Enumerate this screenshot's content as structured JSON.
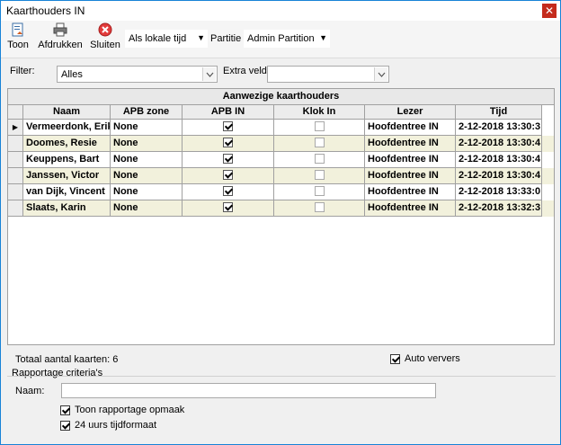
{
  "window": {
    "title": "Kaarthouders IN",
    "close_glyph": "✕"
  },
  "toolbar": {
    "buttons": [
      {
        "label": "Toon",
        "icon": "document-icon"
      },
      {
        "label": "Afdrukken",
        "icon": "printer-icon"
      },
      {
        "label": "Sluiten",
        "icon": "close-circle-icon"
      }
    ],
    "time_mode": "Als lokale tijd",
    "partition_label": "Partitie",
    "partition_value": "Admin Partition"
  },
  "filter": {
    "label": "Filter:",
    "value": "Alles",
    "extra_label": "Extra veld",
    "extra_value": ""
  },
  "grid": {
    "caption": "Aanwezige kaarthouders",
    "columns": [
      "Naam",
      "APB zone",
      "APB IN",
      "Klok In",
      "Lezer",
      "Tijd"
    ],
    "rows": [
      {
        "naam": "Vermeerdonk, Erik",
        "apb_zone": "None",
        "apb_in": true,
        "klok_in": false,
        "lezer": "Hoofdentree IN",
        "tijd": "2-12-2018 13:30:3",
        "selected": true
      },
      {
        "naam": "Doomes, Resie",
        "apb_zone": "None",
        "apb_in": true,
        "klok_in": false,
        "lezer": "Hoofdentree IN",
        "tijd": "2-12-2018 13:30:4",
        "selected": false
      },
      {
        "naam": "Keuppens, Bart",
        "apb_zone": "None",
        "apb_in": true,
        "klok_in": false,
        "lezer": "Hoofdentree IN",
        "tijd": "2-12-2018 13:30:4",
        "selected": false
      },
      {
        "naam": "Janssen, Victor",
        "apb_zone": "None",
        "apb_in": true,
        "klok_in": false,
        "lezer": "Hoofdentree IN",
        "tijd": "2-12-2018 13:30:4",
        "selected": false
      },
      {
        "naam": "van Dijk, Vincent",
        "apb_zone": "None",
        "apb_in": true,
        "klok_in": false,
        "lezer": "Hoofdentree IN",
        "tijd": "2-12-2018 13:33:0",
        "selected": false
      },
      {
        "naam": "Slaats, Karin",
        "apb_zone": "None",
        "apb_in": true,
        "klok_in": false,
        "lezer": "Hoofdentree IN",
        "tijd": "2-12-2018 13:32:3",
        "selected": false
      }
    ]
  },
  "footer": {
    "total_label": "Totaal aantal kaarten: 6",
    "auto_refresh_label": "Auto ververs",
    "auto_refresh_checked": true,
    "report_group_label": "Rapportage criteria's",
    "name_label": "Naam:",
    "name_value": "",
    "show_layout_label": "Toon rapportage opmaak",
    "show_layout_checked": true,
    "format24_label": "24 uurs tijdformaat",
    "format24_checked": true
  }
}
